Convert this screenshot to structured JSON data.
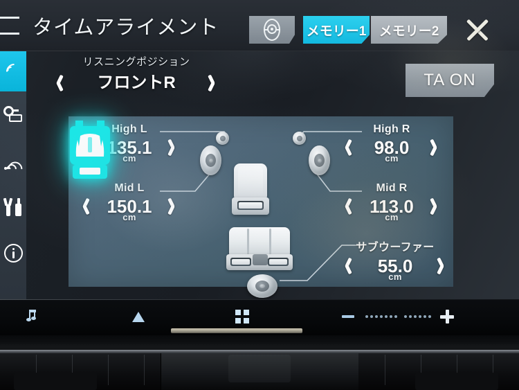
{
  "header": {
    "back_icon": "back-arrow-icon",
    "title": "タイムアライメント",
    "speaker_icon": "speaker-preset-icon",
    "memory_tabs": [
      {
        "label": "メモリー1",
        "active": true
      },
      {
        "label": "メモリー2",
        "active": false
      }
    ],
    "close_icon": "close-icon",
    "accent_color": "#18bfe3"
  },
  "sidebar": {
    "items": [
      {
        "icon": "sound-wave-icon",
        "active": true
      },
      {
        "icon": "speaker-display-icon",
        "active": false
      },
      {
        "icon": "wifi-signal-icon",
        "active": false
      },
      {
        "icon": "tools-wrench-icon",
        "active": false
      },
      {
        "icon": "info-circle-icon",
        "active": false
      }
    ]
  },
  "listening_position": {
    "label": "リスニングポジション",
    "value": "フロントR",
    "prev_icon": "chevron-left-icon",
    "next_icon": "chevron-right-icon"
  },
  "ta_button": {
    "label": "TA ON",
    "state": "on"
  },
  "panel": {
    "unit": "cm",
    "speakers": [
      {
        "name": "high-left",
        "label": "High L",
        "value": "135.1",
        "unit": "cm"
      },
      {
        "name": "mid-left",
        "label": "Mid L",
        "value": "150.1",
        "unit": "cm"
      },
      {
        "name": "high-right",
        "label": "High R",
        "value": "98.0",
        "unit": "cm"
      },
      {
        "name": "mid-right",
        "label": "Mid R",
        "value": "113.0",
        "unit": "cm"
      },
      {
        "name": "subwoofer",
        "label": "サブウーファー",
        "value": "55.0",
        "unit": "cm"
      }
    ],
    "diagram": {
      "front_left_seat": "seat-front-left",
      "front_right_seat": "seat-front-right-selected",
      "rear_bench": "seat-rear-bench",
      "selected_seat_color": "#16e6e6",
      "tweeter_left": "tweeter-left-icon",
      "tweeter_right": "tweeter-right-icon",
      "mid_left": "mid-speaker-left-icon",
      "mid_right": "mid-speaker-right-icon",
      "subwoofer": "subwoofer-icon"
    }
  },
  "bottom_bar": {
    "buttons": [
      {
        "icon": "music-note-icon"
      },
      {
        "icon": "eject-up-arrow-icon"
      },
      {
        "icon": "apps-grid-icon"
      },
      {
        "icon": "volume-minus-icon"
      },
      {
        "icon": "volume-plus-icon"
      }
    ],
    "volume_dots_total": 14,
    "volume_dots_filled": 7
  }
}
